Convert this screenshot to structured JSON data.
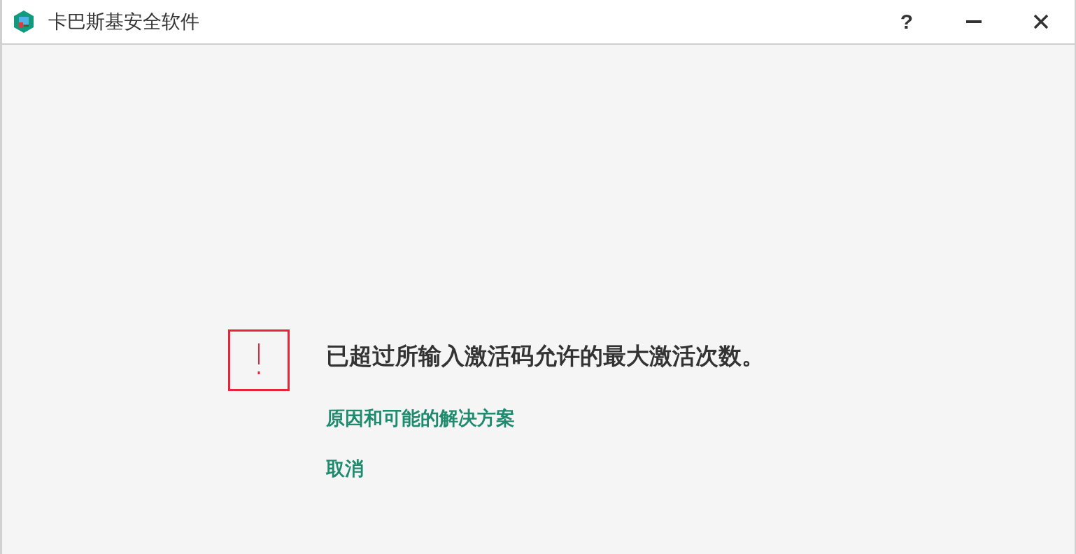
{
  "window": {
    "title": "卡巴斯基安全软件",
    "help": "?"
  },
  "message": "已超过所输入激活码允许的最大激活次数。",
  "links": [
    "原因和可能的解决方案",
    "取消"
  ]
}
